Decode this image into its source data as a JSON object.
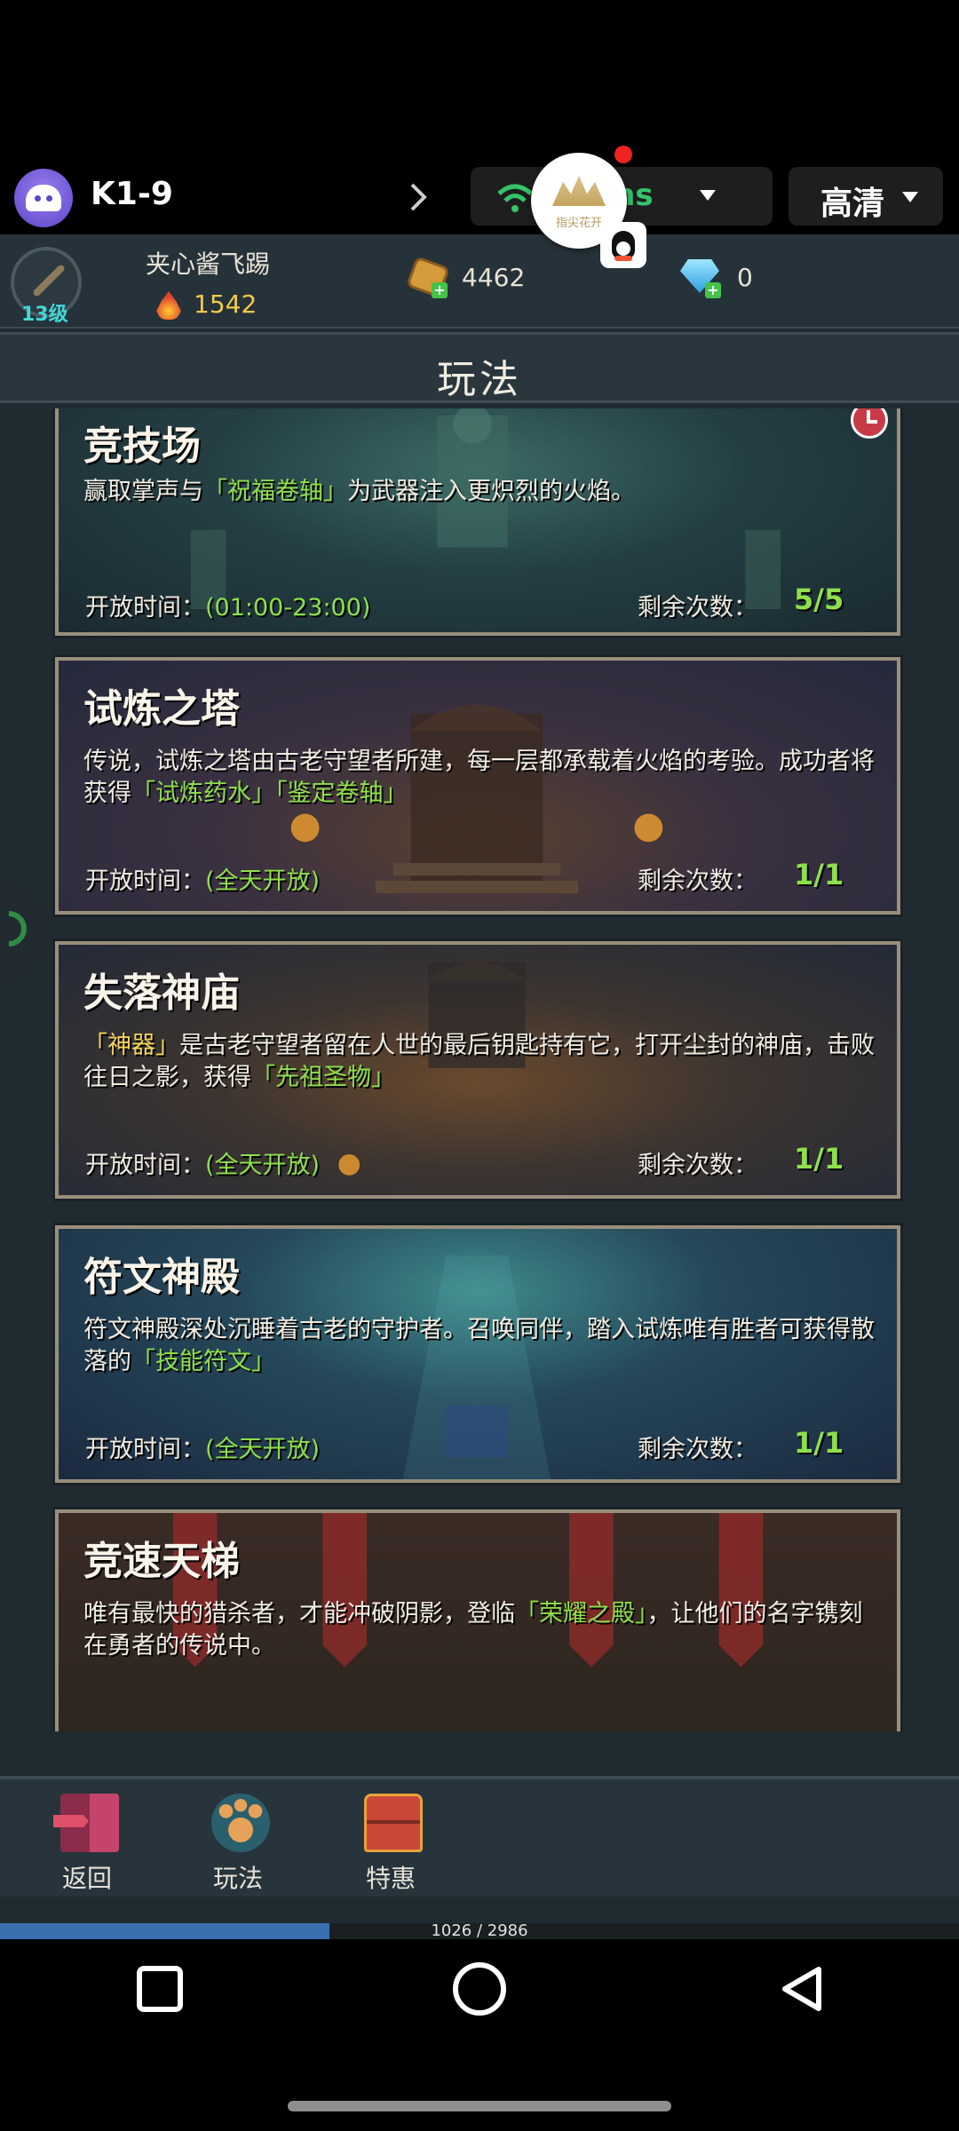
{
  "cloud_bar": {
    "game_id": "K1-9",
    "latency": "ms",
    "quality": "高清",
    "bubble_caption": "指尖花开"
  },
  "player": {
    "name": "夹心酱飞踢",
    "level": "13级",
    "power": "1542",
    "gold": "4462",
    "gems": "0"
  },
  "section_title": "玩法",
  "cards": [
    {
      "title": "竞技场",
      "desc_before": "赢取掌声与",
      "desc_hl1": "「祝福卷轴」",
      "desc_after": "为武器注入更炽烈的火焰。",
      "open_label": "开放时间：",
      "open_time": "(01:00-23:00)",
      "remain_label": "剩余次数：",
      "count": "5/5"
    },
    {
      "title": "试炼之塔",
      "desc_before": "传说，试炼之塔由古老守望者所建，每一层都承载着火焰的考验。成功者将获得",
      "desc_hl1": "「试炼药水」「鉴定卷轴」",
      "desc_after": "",
      "open_label": "开放时间：",
      "open_time": "(全天开放)",
      "remain_label": "剩余次数：",
      "count": "1/1"
    },
    {
      "title": "失落神庙",
      "desc_hl_pre": "「神器」",
      "desc_before": "是古老守望者留在人世的最后钥匙持有它，打开尘封的神庙，击败往日之影，获得",
      "desc_hl1": "「先祖圣物」",
      "desc_after": "",
      "open_label": "开放时间：",
      "open_time": "(全天开放)",
      "remain_label": "剩余次数：",
      "count": "1/1"
    },
    {
      "title": "符文神殿",
      "desc_before": "符文神殿深处沉睡着古老的守护者。召唤同伴，踏入试炼唯有胜者可获得散落的",
      "desc_hl1": "「技能符文」",
      "desc_after": "",
      "open_label": "开放时间：",
      "open_time": "(全天开放)",
      "remain_label": "剩余次数：",
      "count": "1/1"
    },
    {
      "title": "竞速天梯",
      "desc_before": "唯有最快的猎杀者，才能冲破阴影，登临",
      "desc_hl1": "「荣耀之殿」",
      "desc_after": "，让他们的名字镌刻在勇者的传说中。"
    }
  ],
  "bottom_nav": {
    "back": "返回",
    "play": "玩法",
    "deals": "特惠"
  },
  "progress": {
    "text": "1026 / 2986",
    "current": 1026,
    "total": 2986
  },
  "colors": {
    "accent_green": "#8ee04b",
    "accent_yellow": "#f5d45a",
    "progress_blue": "#3a6faf"
  }
}
